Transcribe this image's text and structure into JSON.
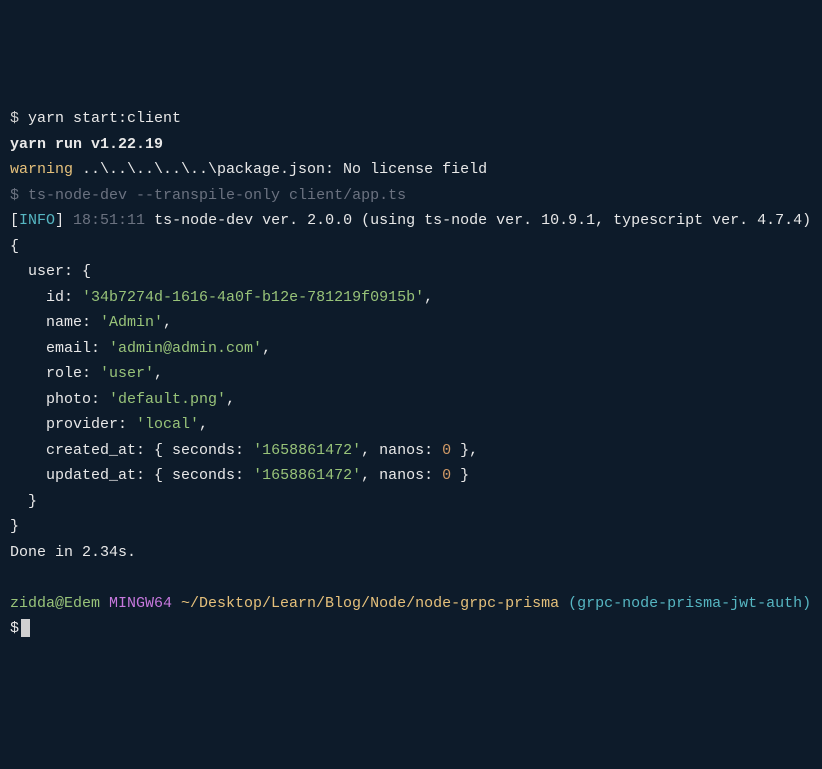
{
  "l1_dollar": "$ ",
  "l1_cmd": "yarn start:client",
  "l2_yarn": "yarn run v1.22.19",
  "l3_warn": "warning",
  "l3_rest": " ..\\..\\..\\..\\..\\package.json: No license field",
  "l4_dollar": "$ ",
  "l4_cmd": "ts-node-dev --transpile-only client/app.ts",
  "l5_br1": "[",
  "l5_info": "INFO",
  "l5_br2": "] ",
  "l5_time": "18:51:11",
  "l5_rest": " ts-node-dev ver. 2.0.0 (using ts-node ver. 10.9.1, typescript ver. 4.7.4)",
  "obj_open": "{",
  "obj_user_line": "  user: {",
  "obj_id_k": "    id: ",
  "obj_id_v": "'34b7274d-1616-4a0f-b12e-781219f0915b'",
  "obj_name_k": "    name: ",
  "obj_name_v": "'Admin'",
  "obj_email_k": "    email: ",
  "obj_email_v": "'admin@admin.com'",
  "obj_role_k": "    role: ",
  "obj_role_v": "'user'",
  "obj_photo_k": "    photo: ",
  "obj_photo_v": "'default.png'",
  "obj_provider_k": "    provider: ",
  "obj_provider_v": "'local'",
  "obj_created_k": "    created_at: { seconds: ",
  "obj_created_sec": "'1658861472'",
  "obj_created_mid": ", nanos: ",
  "obj_created_nanos": "0",
  "obj_created_end": " },",
  "obj_updated_k": "    updated_at: { seconds: ",
  "obj_updated_sec": "'1658861472'",
  "obj_updated_mid": ", nanos: ",
  "obj_updated_nanos": "0",
  "obj_updated_end": " }",
  "obj_user_close": "  }",
  "obj_close": "}",
  "comma": ",",
  "done": "Done in 2.34s.",
  "blank": " ",
  "ps1_user": "zidda@Edem",
  "ps1_env": " MINGW64",
  "ps1_path": " ~/Desktop/Learn/Blog/Node/node-grpc-prisma",
  "ps1_branch": " (grpc-node-prisma-jwt-auth)",
  "ps1_dollar": "$"
}
